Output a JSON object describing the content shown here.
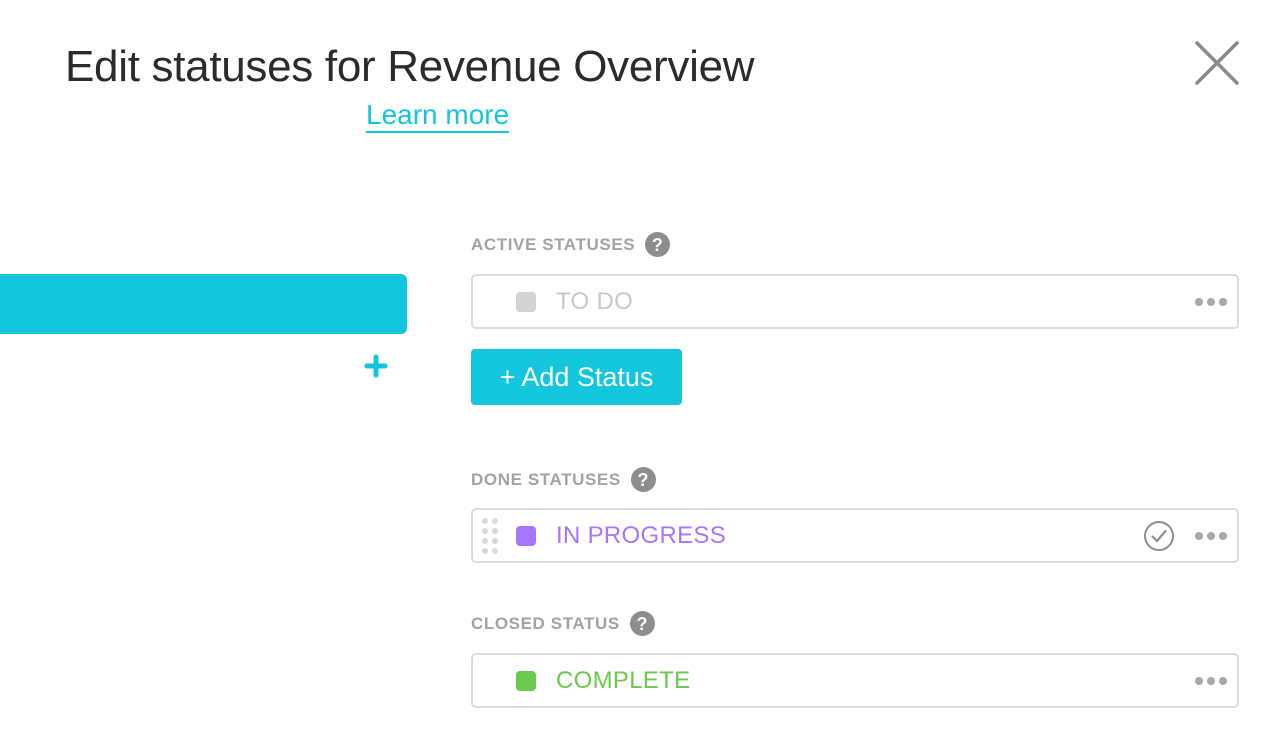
{
  "header": {
    "title": "Edit statuses for Revenue Overview",
    "learn_more": "Learn more"
  },
  "colors": {
    "accent": "#13c6de",
    "todo": "#d3d3d3",
    "in_progress": "#a875ff",
    "complete": "#6bc950"
  },
  "sections": {
    "active": {
      "label": "ACTIVE STATUSES",
      "help": "?",
      "statuses": [
        {
          "name": "TO DO",
          "color": "#d3d3d3",
          "text_color": "#c8c8c8"
        }
      ]
    },
    "add_status_label": "+ Add Status",
    "done": {
      "label": "DONE STATUSES",
      "help": "?",
      "statuses": [
        {
          "name": "IN PROGRESS",
          "color": "#a875ff",
          "text_color": "#a875ff"
        }
      ]
    },
    "closed": {
      "label": "CLOSED STATUS",
      "help": "?",
      "statuses": [
        {
          "name": "COMPLETE",
          "color": "#6bc950",
          "text_color": "#6bc950"
        }
      ]
    }
  },
  "icons": {
    "close": "close-icon",
    "help": "help-circle-icon",
    "more": "more-horizontal-icon",
    "check": "check-circle-icon",
    "drag": "drag-handle-icon",
    "plus": "plus-icon"
  }
}
